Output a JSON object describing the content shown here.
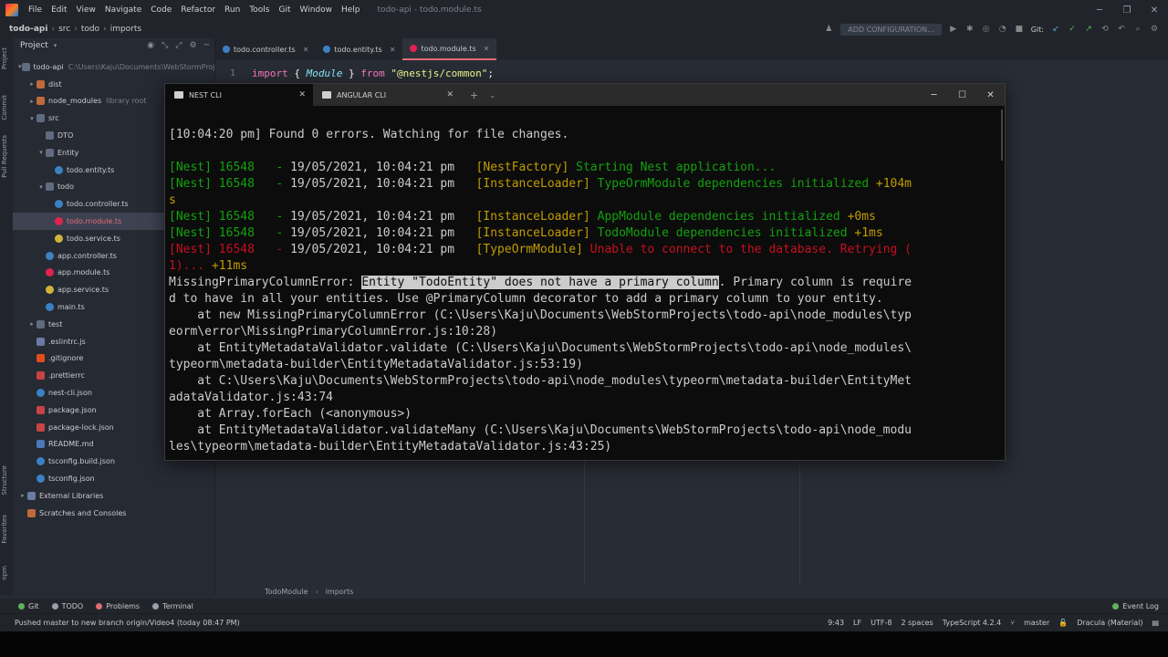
{
  "menu": {
    "items": [
      "File",
      "Edit",
      "View",
      "Navigate",
      "Code",
      "Refactor",
      "Run",
      "Tools",
      "Git",
      "Window",
      "Help"
    ],
    "window_title": "todo-api - todo.module.ts"
  },
  "navbar": {
    "crumbs": [
      "todo-api",
      "src",
      "todo",
      "imports"
    ],
    "add_config": "ADD CONFIGURATION...",
    "git_label": "Git:"
  },
  "project": {
    "title": "Project",
    "tree": [
      {
        "name": "todo-api",
        "hint": "C:\\Users\\Kaju\\Documents\\WebStormProjects",
        "indent": 1,
        "arrow": "▾",
        "icon": "folder"
      },
      {
        "name": "dist",
        "hint": "",
        "indent": 2,
        "arrow": "▸",
        "icon": "folder-red"
      },
      {
        "name": "node_modules",
        "hint": "library root",
        "indent": 2,
        "arrow": "▸",
        "icon": "folder-red"
      },
      {
        "name": "src",
        "hint": "",
        "indent": 2,
        "arrow": "▾",
        "icon": "folder"
      },
      {
        "name": "DTO",
        "hint": "",
        "indent": 3,
        "arrow": "",
        "icon": "folder"
      },
      {
        "name": "Entity",
        "hint": "",
        "indent": 3,
        "arrow": "▾",
        "icon": "folder"
      },
      {
        "name": "todo.entity.ts",
        "hint": "",
        "indent": 4,
        "arrow": "",
        "icon": "ts"
      },
      {
        "name": "todo",
        "hint": "",
        "indent": 3,
        "arrow": "▾",
        "icon": "folder"
      },
      {
        "name": "todo.controller.ts",
        "hint": "",
        "indent": 4,
        "arrow": "",
        "icon": "ts"
      },
      {
        "name": "todo.module.ts",
        "hint": "",
        "indent": 4,
        "arrow": "",
        "icon": "nest",
        "selected": true
      },
      {
        "name": "todo.service.ts",
        "hint": "",
        "indent": 4,
        "arrow": "",
        "icon": "svc"
      },
      {
        "name": "app.controller.ts",
        "hint": "",
        "indent": 3,
        "arrow": "",
        "icon": "ts"
      },
      {
        "name": "app.module.ts",
        "hint": "",
        "indent": 3,
        "arrow": "",
        "icon": "nest"
      },
      {
        "name": "app.service.ts",
        "hint": "",
        "indent": 3,
        "arrow": "",
        "icon": "svc"
      },
      {
        "name": "main.ts",
        "hint": "",
        "indent": 3,
        "arrow": "",
        "icon": "ts"
      },
      {
        "name": "test",
        "hint": "",
        "indent": 2,
        "arrow": "▸",
        "icon": "folder"
      },
      {
        "name": ".eslintrc.js",
        "hint": "",
        "indent": 2,
        "arrow": "",
        "icon": "lib"
      },
      {
        "name": ".gitignore",
        "hint": "",
        "indent": 2,
        "arrow": "",
        "icon": "git"
      },
      {
        "name": ".prettierrc",
        "hint": "",
        "indent": 2,
        "arrow": "",
        "icon": "json"
      },
      {
        "name": "nest-cli.json",
        "hint": "",
        "indent": 2,
        "arrow": "",
        "icon": "ts"
      },
      {
        "name": "package.json",
        "hint": "",
        "indent": 2,
        "arrow": "",
        "icon": "json"
      },
      {
        "name": "package-lock.json",
        "hint": "",
        "indent": 2,
        "arrow": "",
        "icon": "json"
      },
      {
        "name": "README.md",
        "hint": "",
        "indent": 2,
        "arrow": "",
        "icon": "md"
      },
      {
        "name": "tsconfig.build.json",
        "hint": "",
        "indent": 2,
        "arrow": "",
        "icon": "ts"
      },
      {
        "name": "tsconfig.json",
        "hint": "",
        "indent": 2,
        "arrow": "",
        "icon": "ts"
      },
      {
        "name": "External Libraries",
        "hint": "",
        "indent": 1,
        "arrow": "▸",
        "icon": "lib"
      },
      {
        "name": "Scratches and Consoles",
        "hint": "",
        "indent": 1,
        "arrow": "",
        "icon": "folder-red"
      }
    ]
  },
  "left_strip": [
    "Project",
    "Commit",
    "Pull Requests"
  ],
  "left_strip_bottom": [
    "Structure",
    "Favorites",
    "npm"
  ],
  "editor": {
    "tabs": [
      {
        "label": "todo.controller.ts",
        "icon": "ts"
      },
      {
        "label": "todo.entity.ts",
        "icon": "ts"
      },
      {
        "label": "todo.module.ts",
        "icon": "nest",
        "active": true
      }
    ],
    "line_number": "1",
    "code": {
      "kw1": "import",
      "open": " { ",
      "cls": "Module",
      "close": " } ",
      "kw2": "from",
      "sp": " ",
      "str": "\"@nestjs/common\"",
      "end": ";"
    },
    "breadcrumbs": [
      "TodoModule",
      "imports"
    ]
  },
  "terminal": {
    "tabs": [
      {
        "label": "NEST CLI",
        "active": true
      },
      {
        "label": "ANGULAR CLI"
      }
    ],
    "lines": [
      [
        {
          "t": "[",
          "c": "white"
        },
        {
          "t": "10:04:20 pm",
          "c": "white"
        },
        {
          "t": "] Found 0 errors. Watching for file changes.",
          "c": "white"
        }
      ],
      [],
      [
        {
          "t": "[Nest] 16548   - ",
          "c": "green"
        },
        {
          "t": "19/05/2021, 10:04:21 pm   ",
          "c": "white"
        },
        {
          "t": "[NestFactory] ",
          "c": "yellow"
        },
        {
          "t": "Starting Nest application...",
          "c": "green"
        }
      ],
      [
        {
          "t": "[Nest] 16548   - ",
          "c": "green"
        },
        {
          "t": "19/05/2021, 10:04:21 pm   ",
          "c": "white"
        },
        {
          "t": "[InstanceLoader] ",
          "c": "yellow"
        },
        {
          "t": "TypeOrmModule dependencies initialized ",
          "c": "green"
        },
        {
          "t": "+104m",
          "c": "yellow"
        }
      ],
      [
        {
          "t": "s",
          "c": "yellow"
        }
      ],
      [
        {
          "t": "[Nest] 16548   - ",
          "c": "green"
        },
        {
          "t": "19/05/2021, 10:04:21 pm   ",
          "c": "white"
        },
        {
          "t": "[InstanceLoader] ",
          "c": "yellow"
        },
        {
          "t": "AppModule dependencies initialized ",
          "c": "green"
        },
        {
          "t": "+0ms",
          "c": "yellow"
        }
      ],
      [
        {
          "t": "[Nest] 16548   - ",
          "c": "green"
        },
        {
          "t": "19/05/2021, 10:04:21 pm   ",
          "c": "white"
        },
        {
          "t": "[InstanceLoader] ",
          "c": "yellow"
        },
        {
          "t": "TodoModule dependencies initialized ",
          "c": "green"
        },
        {
          "t": "+1ms",
          "c": "yellow"
        }
      ],
      [
        {
          "t": "[Nest] 16548   - ",
          "c": "red"
        },
        {
          "t": "19/05/2021, 10:04:21 pm   ",
          "c": "white"
        },
        {
          "t": "[TypeOrmModule] ",
          "c": "yellow"
        },
        {
          "t": "Unable to connect to the database. Retrying (",
          "c": "red"
        }
      ],
      [
        {
          "t": "1)... ",
          "c": "red"
        },
        {
          "t": "+11ms",
          "c": "yellow"
        }
      ],
      [
        {
          "t": "MissingPrimaryColumnError: ",
          "c": "white"
        },
        {
          "t": "Entity \"TodoEntity\" does not have a primary column",
          "c": "hl"
        },
        {
          "t": ". Primary column is require",
          "c": "white"
        }
      ],
      [
        {
          "t": "d to have in all your entities. Use @PrimaryColumn decorator to add a primary column to your entity.",
          "c": "white"
        }
      ],
      [
        {
          "t": "    at new MissingPrimaryColumnError (C:\\Users\\Kaju\\Documents\\WebStormProjects\\todo-api\\node_modules\\typ",
          "c": "white"
        }
      ],
      [
        {
          "t": "eorm\\error\\MissingPrimaryColumnError.js:10:28)",
          "c": "white"
        }
      ],
      [
        {
          "t": "    at EntityMetadataValidator.validate (C:\\Users\\Kaju\\Documents\\WebStormProjects\\todo-api\\node_modules\\",
          "c": "white"
        }
      ],
      [
        {
          "t": "typeorm\\metadata-builder\\EntityMetadataValidator.js:53:19)",
          "c": "white"
        }
      ],
      [
        {
          "t": "    at C:\\Users\\Kaju\\Documents\\WebStormProjects\\todo-api\\node_modules\\typeorm\\metadata-builder\\EntityMet",
          "c": "white"
        }
      ],
      [
        {
          "t": "adataValidator.js:43:74",
          "c": "white"
        }
      ],
      [
        {
          "t": "    at Array.forEach (<anonymous>)",
          "c": "white"
        }
      ],
      [
        {
          "t": "    at EntityMetadataValidator.validateMany (C:\\Users\\Kaju\\Documents\\WebStormProjects\\todo-api\\node_modu",
          "c": "white"
        }
      ],
      [
        {
          "t": "les\\typeorm\\metadata-builder\\EntityMetadataValidator.js:43:25)",
          "c": "white"
        }
      ]
    ]
  },
  "bottom_tools": [
    {
      "label": "Git",
      "color": "#5db35d"
    },
    {
      "label": "TODO",
      "color": "#9aa0aa"
    },
    {
      "label": "Problems",
      "color": "#e06c75"
    },
    {
      "label": "Terminal",
      "color": "#9aa0aa"
    }
  ],
  "event_log": "Event Log",
  "status": {
    "message": "Pushed master to new branch origin/Video4 (today 08:47 PM)",
    "position": "9:43",
    "line_sep": "LF",
    "encoding": "UTF-8",
    "indent": "2 spaces",
    "language": "TypeScript 4.2.4",
    "branch": "master",
    "theme": "Dracula (Material)"
  },
  "colors": {
    "terminal_bg": "#0c0c0c",
    "ide_bg": "#262a33",
    "accent_red": "#e06c75"
  }
}
